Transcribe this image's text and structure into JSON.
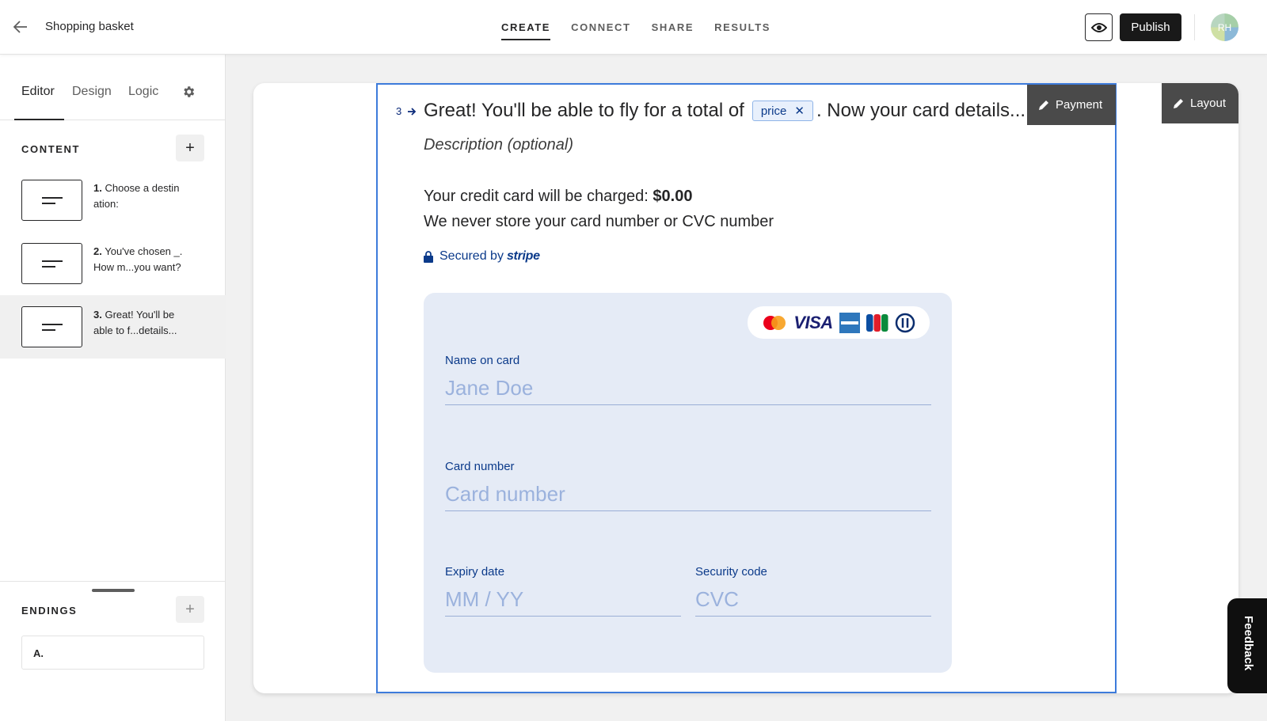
{
  "header": {
    "back_icon": "arrow-left-icon",
    "title": "Shopping basket",
    "tabs": [
      {
        "label": "CREATE",
        "active": true
      },
      {
        "label": "CONNECT",
        "active": false
      },
      {
        "label": "SHARE",
        "active": false
      },
      {
        "label": "RESULTS",
        "active": false
      }
    ],
    "preview_icon": "eye-icon",
    "publish_label": "Publish",
    "avatar_initials": "RH"
  },
  "sidebar": {
    "tabs": [
      {
        "label": "Editor",
        "active": true
      },
      {
        "label": "Design",
        "active": false
      },
      {
        "label": "Logic",
        "active": false
      }
    ],
    "settings_icon": "gear-icon",
    "content_label": "CONTENT",
    "add_label": "+",
    "questions": [
      {
        "num": "1.",
        "text": "Choose a destin ation:"
      },
      {
        "num": "2.",
        "text": "You've chosen _. How m...you want?"
      },
      {
        "num": "3.",
        "text": "Great! You'll be able to f...details..."
      }
    ],
    "active_question_index": 2,
    "endings_label": "ENDINGS",
    "endings": [
      {
        "label": "A."
      }
    ]
  },
  "block": {
    "question_number": "3",
    "question_before": "Great! You'll be able to fly for a total of",
    "question_chip": "price",
    "question_after": ". Now your card details...",
    "badge_payment": "Payment",
    "badge_layout": "Layout",
    "description": "Description (optional)",
    "charge_prefix": "Your credit card will be charged:",
    "charge_amount": "$0.00",
    "privacy_note": "We never store your card number or CVC number",
    "secured_prefix": "Secured by",
    "secured_brand": "stripe",
    "card_brands": [
      "mastercard-icon",
      "visa-icon",
      "amex-icon",
      "jcb-icon",
      "diners-icon"
    ],
    "visa_text": "VISA",
    "fields": {
      "name_label": "Name on card",
      "name_placeholder": "Jane Doe",
      "number_label": "Card number",
      "number_placeholder": "Card number",
      "expiry_label": "Expiry date",
      "expiry_placeholder": "MM / YY",
      "cvc_label": "Security code",
      "cvc_placeholder": "CVC"
    }
  },
  "feedback_label": "Feedback",
  "colors": {
    "accent_blue": "#3d7bdb",
    "text_navy": "#0b3a8a",
    "card_bg": "#e5ebf6",
    "badge_bg": "#4a4a4a"
  }
}
